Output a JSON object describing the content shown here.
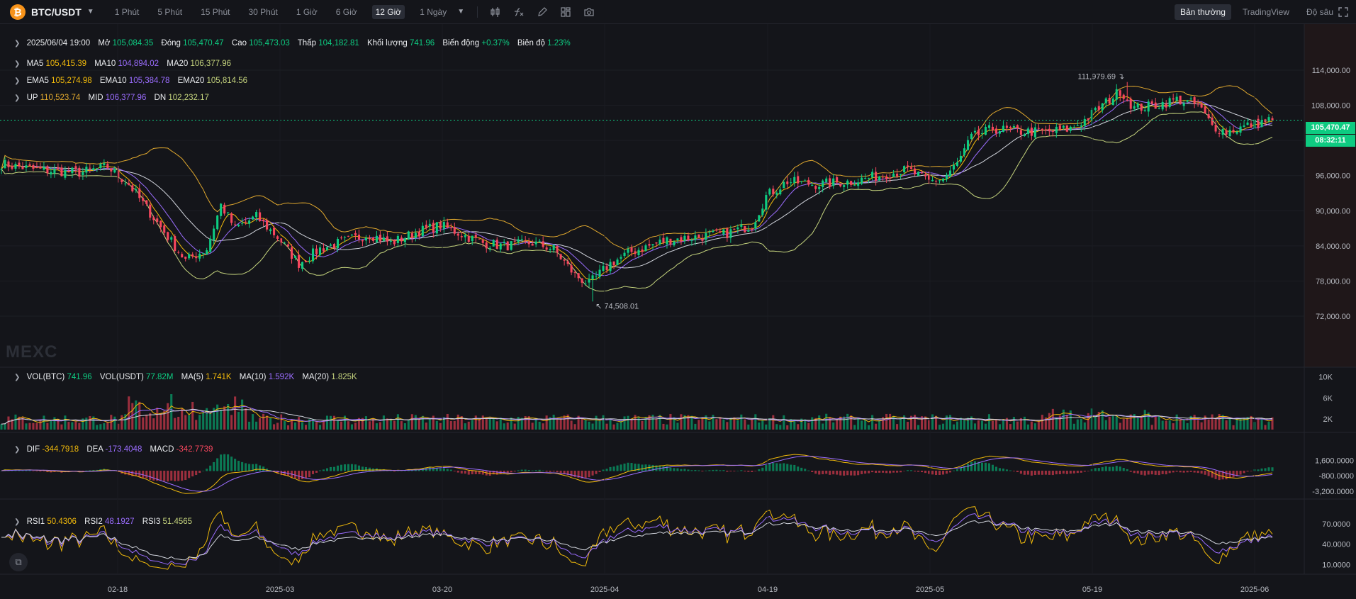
{
  "toolbar": {
    "symbol": "BTC/USDT",
    "symbol_icon": "₿",
    "intervals": [
      "1 Phút",
      "5 Phút",
      "15 Phút",
      "30 Phút",
      "1 Giờ",
      "6 Giờ",
      "12 Giờ",
      "1 Ngày"
    ],
    "active_interval": "12 Giờ",
    "views": [
      "Bản thường",
      "TradingView",
      "Độ sâu"
    ],
    "active_view": "Bản thường"
  },
  "ohlc": {
    "date": "2025/06/04 19:00",
    "open_label": "Mở",
    "open": "105,084.35",
    "close_label": "Đóng",
    "close": "105,470.47",
    "high_label": "Cao",
    "high": "105,473.03",
    "low_label": "Thấp",
    "low": "104,182.81",
    "volume_label": "Khối lượng",
    "volume": "741.96",
    "change_label": "Biến động",
    "change": "+0.37%",
    "amp_label": "Biên độ",
    "amp": "1.23%"
  },
  "ma": {
    "ma5_label": "MA5",
    "ma5": "105,415.39",
    "ma10_label": "MA10",
    "ma10": "104,894.02",
    "ma20_label": "MA20",
    "ma20": "106,377.96"
  },
  "ema": {
    "ema5_label": "EMA5",
    "ema5": "105,274.98",
    "ema10_label": "EMA10",
    "ema10": "105,384.78",
    "ema20_label": "EMA20",
    "ema20": "105,814.56"
  },
  "boll": {
    "up_label": "UP",
    "up": "110,523.74",
    "mid_label": "MID",
    "mid": "106,377.96",
    "dn_label": "DN",
    "dn": "102,232.17"
  },
  "vol": {
    "btc_label": "VOL(BTC)",
    "btc": "741.96",
    "usdt_label": "VOL(USDT)",
    "usdt": "77.82M",
    "ma5_label": "MA(5)",
    "ma5": "1.741K",
    "ma10_label": "MA(10)",
    "ma10": "1.592K",
    "ma20_label": "MA(20)",
    "ma20": "1.825K"
  },
  "macd": {
    "dif_label": "DIF",
    "dif": "-344.7918",
    "dea_label": "DEA",
    "dea": "-173.4048",
    "macd_label": "MACD",
    "macd": "-342.7739"
  },
  "rsi": {
    "rsi1_label": "RSI1",
    "rsi1": "50.4306",
    "rsi2_label": "RSI2",
    "rsi2": "48.1927",
    "rsi3_label": "RSI3",
    "rsi3": "51.4565"
  },
  "price_tag": {
    "price": "105,470.47",
    "countdown": "08:32:11"
  },
  "brand": "MEXC",
  "colors": {
    "up": "#0ecb81",
    "down": "#f6465d",
    "ma5": "#f0b90b",
    "ma10": "#9b6dff",
    "ma20": "#d1d4dc",
    "boll_up": "#e0a82e",
    "boll_dn": "#c6d57e",
    "bg": "#14151a"
  },
  "chart_data": {
    "type": "candlestick",
    "interval": "12 Giờ",
    "x_ticks": [
      "02-18",
      "2025-03",
      "03-20",
      "2025-04",
      "04-19",
      "2025-05",
      "05-19",
      "2025-06"
    ],
    "price_axis": [
      "114,000.00",
      "108,000.00",
      "102,000.00",
      "96,000.00",
      "90,000.00",
      "84,000.00",
      "78,000.00",
      "72,000.00"
    ],
    "price_range": [
      72000,
      114000
    ],
    "price_anchors": [
      [
        0,
        98000
      ],
      [
        10,
        97000
      ],
      [
        22,
        96500
      ],
      [
        30,
        97500
      ],
      [
        36,
        94500
      ],
      [
        44,
        88000
      ],
      [
        52,
        81500
      ],
      [
        58,
        83500
      ],
      [
        62,
        91000
      ],
      [
        66,
        87000
      ],
      [
        72,
        89000
      ],
      [
        78,
        85500
      ],
      [
        84,
        81000
      ],
      [
        90,
        83500
      ],
      [
        98,
        85000
      ],
      [
        104,
        86000
      ],
      [
        110,
        84500
      ],
      [
        118,
        86500
      ],
      [
        124,
        87500
      ],
      [
        130,
        86000
      ],
      [
        136,
        84500
      ],
      [
        142,
        84000
      ],
      [
        150,
        84500
      ],
      [
        156,
        83500
      ],
      [
        162,
        79000
      ],
      [
        166,
        77500
      ],
      [
        172,
        81000
      ],
      [
        178,
        83000
      ],
      [
        188,
        85000
      ],
      [
        196,
        85500
      ],
      [
        204,
        86000
      ],
      [
        212,
        87500
      ],
      [
        216,
        92500
      ],
      [
        222,
        95000
      ],
      [
        230,
        94500
      ],
      [
        240,
        95000
      ],
      [
        248,
        96000
      ],
      [
        256,
        97000
      ],
      [
        262,
        95000
      ],
      [
        266,
        95500
      ],
      [
        270,
        98000
      ],
      [
        274,
        102500
      ],
      [
        280,
        104000
      ],
      [
        288,
        103500
      ],
      [
        296,
        103500
      ],
      [
        302,
        104000
      ],
      [
        306,
        105500
      ],
      [
        312,
        108500
      ],
      [
        316,
        110500
      ],
      [
        320,
        107500
      ],
      [
        326,
        108000
      ],
      [
        332,
        109000
      ],
      [
        338,
        108000
      ],
      [
        342,
        104500
      ],
      [
        346,
        103500
      ],
      [
        352,
        104500
      ],
      [
        358,
        105470
      ]
    ],
    "high": {
      "label": "111,979.69",
      "value": 111979.69
    },
    "low": {
      "label": "74,508.01",
      "value": 74508.01
    },
    "last": 105470.47,
    "vol_axis": [
      "10K",
      "6K",
      "2K"
    ],
    "macd_axis": [
      "1,600.0000",
      "-800.0000",
      "-3,200.0000"
    ],
    "rsi_axis": [
      "70.0000",
      "40.0000",
      "10.0000"
    ]
  }
}
